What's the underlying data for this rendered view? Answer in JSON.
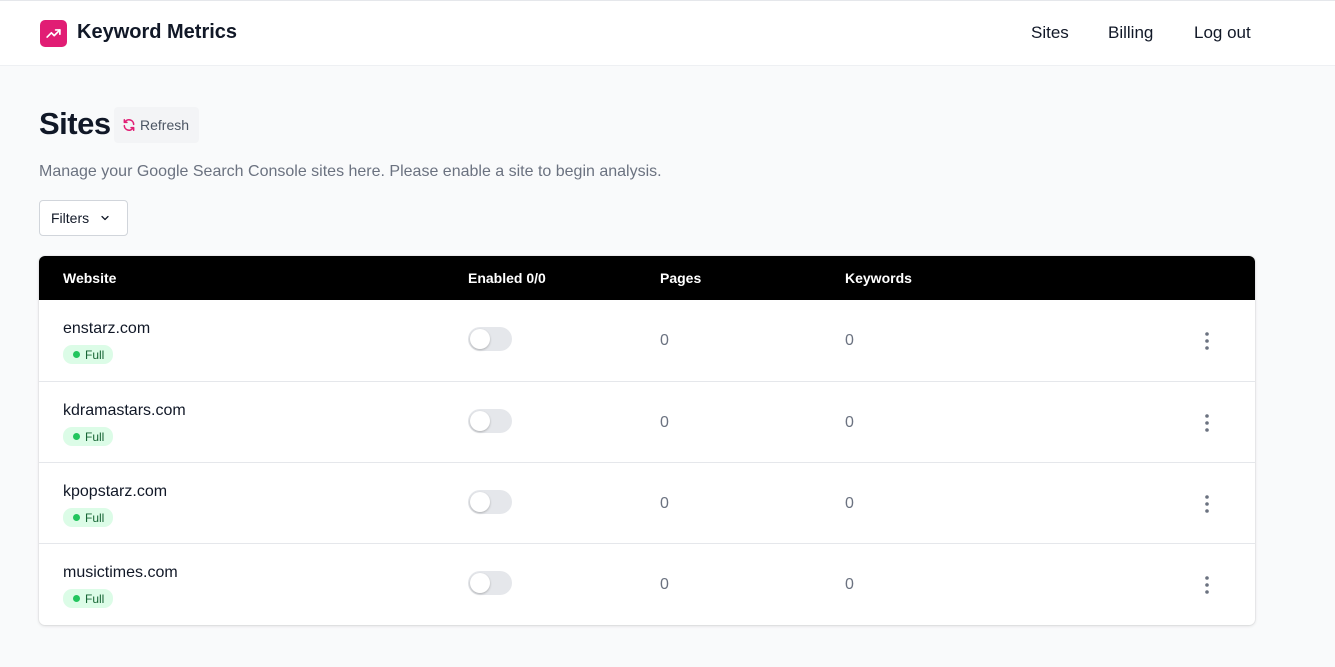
{
  "app": {
    "title": "Keyword Metrics",
    "brand_color": "#e11d74",
    "logo_icon": "trending-up-icon"
  },
  "nav": {
    "sites": "Sites",
    "billing": "Billing",
    "logout": "Log out"
  },
  "page": {
    "title": "Sites",
    "refresh_label": "Refresh",
    "description": "Manage your Google Search Console sites here. Please enable a site to begin analysis.",
    "filters_label": "Filters"
  },
  "table": {
    "headers": {
      "website": "Website",
      "enabled": "Enabled 0/0",
      "pages": "Pages",
      "keywords": "Keywords"
    },
    "rows": [
      {
        "site": "enstarz.com",
        "access": "Full",
        "enabled": false,
        "pages": "0",
        "keywords": "0"
      },
      {
        "site": "kdramastars.com",
        "access": "Full",
        "enabled": false,
        "pages": "0",
        "keywords": "0"
      },
      {
        "site": "kpopstarz.com",
        "access": "Full",
        "enabled": false,
        "pages": "0",
        "keywords": "0"
      },
      {
        "site": "musictimes.com",
        "access": "Full",
        "enabled": false,
        "pages": "0",
        "keywords": "0"
      }
    ]
  },
  "colors": {
    "header_bg": "#000000",
    "badge_bg": "#dcfce7",
    "badge_dot": "#22c55e"
  }
}
